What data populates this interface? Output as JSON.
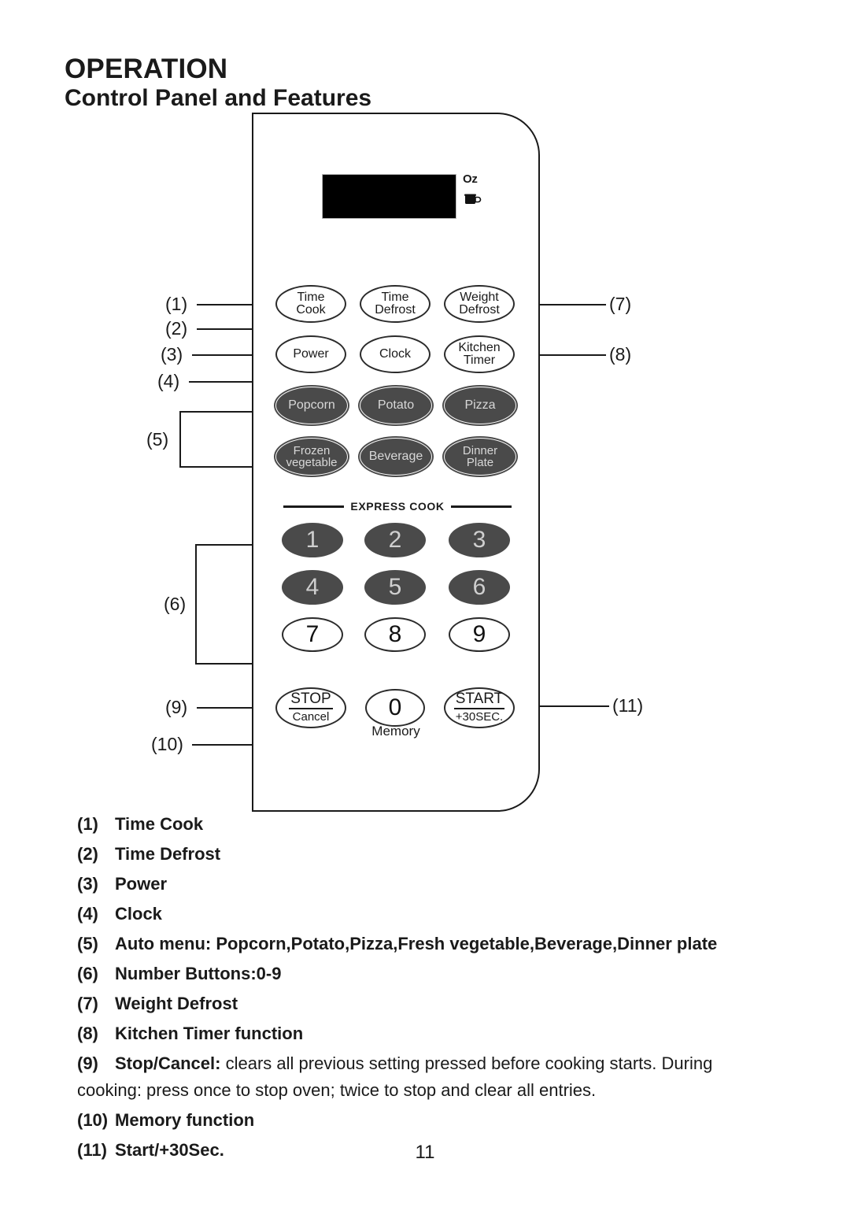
{
  "headings": {
    "operation": "OPERATION",
    "subtitle": "Control Panel and Features"
  },
  "display": {
    "oz_label": "Oz",
    "cup_icon": "cup-icon",
    "screen_value": ""
  },
  "panel": {
    "express_label": "EXPRESS COOK",
    "memory_label": "Memory",
    "function_buttons": [
      {
        "line1": "Time",
        "line2": "Cook"
      },
      {
        "line1": "Time",
        "line2": "Defrost"
      },
      {
        "line1": "Weight",
        "line2": "Defrost"
      },
      {
        "line1": "Power",
        "line2": ""
      },
      {
        "line1": "Clock",
        "line2": ""
      },
      {
        "line1": "Kitchen",
        "line2": "Timer"
      }
    ],
    "auto_menu_buttons": [
      {
        "line1": "Popcorn",
        "line2": ""
      },
      {
        "line1": "Potato",
        "line2": ""
      },
      {
        "line1": "Pizza",
        "line2": ""
      },
      {
        "line1": "Frozen",
        "line2": "vegetable"
      },
      {
        "line1": "Beverage",
        "line2": ""
      },
      {
        "line1": "Dinner",
        "line2": "Plate"
      }
    ],
    "number_buttons": [
      "1",
      "2",
      "3",
      "4",
      "5",
      "6",
      "7",
      "8",
      "9"
    ],
    "zero_button": "0",
    "stop_button": {
      "top": "STOP",
      "bottom": "Cancel"
    },
    "start_button": {
      "top": "START",
      "bottom": "+30SEC."
    }
  },
  "callouts": {
    "c1": "(1)",
    "c2": "(2)",
    "c3": "(3)",
    "c4": "(4)",
    "c5": "(5)",
    "c6": "(6)",
    "c7": "(7)",
    "c8": "(8)",
    "c9": "(9)",
    "c10": "(10)",
    "c11": "(11)"
  },
  "features": [
    {
      "num": "(1)",
      "text": "Time Cook"
    },
    {
      "num": "(2)",
      "text": "Time Defrost"
    },
    {
      "num": "(3)",
      "text": "Power"
    },
    {
      "num": "(4)",
      "text": "Clock"
    },
    {
      "num": "(5)",
      "text": "Auto menu: Popcorn,Potato,Pizza,Fresh vegetable,Beverage,Dinner plate"
    },
    {
      "num": "(6)",
      "text": "Number Buttons:0-9"
    },
    {
      "num": "(7)",
      "text": "Weight Defrost"
    },
    {
      "num": "(8)",
      "text": "Kitchen Timer function"
    },
    {
      "num": "(9)",
      "bold_lead": "Stop/Cancel:",
      "text": " clears all previous setting pressed before cooking starts. During"
    },
    {
      "num": "",
      "text": "cooking: press once to stop oven;  twice  to stop and clear all entries."
    },
    {
      "num": "(10)",
      "text": "Memory function"
    },
    {
      "num": "(11)",
      "text": "Start/+30Sec."
    }
  ],
  "page_number": "11"
}
